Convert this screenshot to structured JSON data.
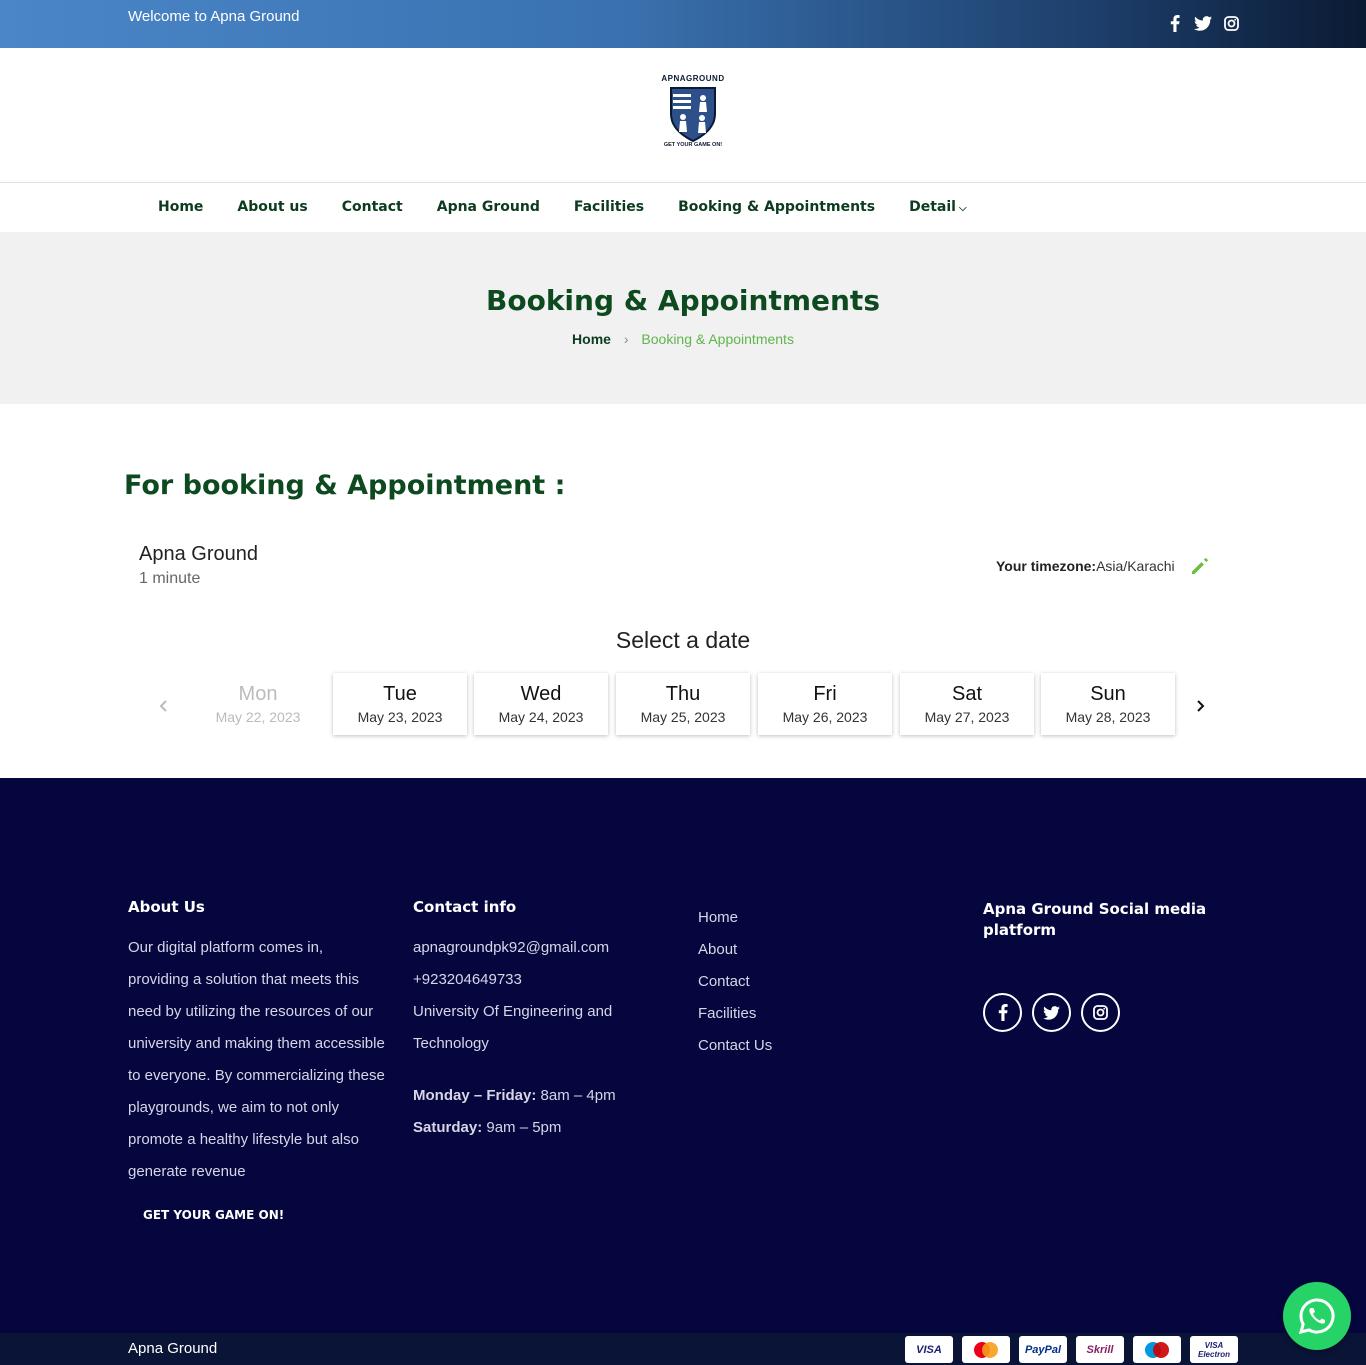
{
  "topbar": {
    "welcome": "Welcome to Apna Ground"
  },
  "logo": {
    "arc_text": "APNAGROUND",
    "tagline": "GET YOUR GAME ON!"
  },
  "nav": {
    "items": [
      "Home",
      "About us",
      "Contact",
      "Apna Ground",
      "Facilities",
      "Booking & Appointments",
      "Detail"
    ]
  },
  "hero": {
    "title": "Booking & Appointments",
    "crumb_home": "Home",
    "crumb_current": "Booking & Appointments"
  },
  "booking": {
    "section_title": "For booking & Appointment :",
    "event_name": "Apna Ground",
    "duration": "1 minute",
    "timezone_label": "Your timezone:",
    "timezone_value": "Asia/Karachi",
    "select_date": "Select a date",
    "days": [
      {
        "name": "Mon",
        "date": "May 22, 2023",
        "available": false
      },
      {
        "name": "Tue",
        "date": "May 23, 2023",
        "available": true
      },
      {
        "name": "Wed",
        "date": "May 24, 2023",
        "available": true
      },
      {
        "name": "Thu",
        "date": "May 25, 2023",
        "available": true
      },
      {
        "name": "Fri",
        "date": "May 26, 2023",
        "available": true
      },
      {
        "name": "Sat",
        "date": "May 27, 2023",
        "available": true
      },
      {
        "name": "Sun",
        "date": "May 28, 2023",
        "available": true
      }
    ]
  },
  "footer": {
    "about_title": "About Us",
    "about_text": "Our digital platform comes in, providing a solution that meets this need by utilizing the resources of our university and making them accessible to everyone. By commercializing these playgrounds, we aim to not only promote a healthy lifestyle but also generate revenue",
    "about_tagline": "GET YOUR GAME ON!",
    "contact_title": "Contact info",
    "email": "apnagroundpk92@gmail.com",
    "phone": "+923204649733",
    "address": "University Of Engineering and Technology",
    "weekday_label": "Monday – Friday:",
    "weekday_hours": "8am – 4pm",
    "saturday_label": "Saturday:",
    "saturday_hours": "9am – 5pm",
    "links": [
      "Home",
      "About",
      "Contact",
      "Facilities",
      "Contact Us"
    ],
    "social_title": "Apna Ground Social media platform"
  },
  "bottom": {
    "copyright": "Apna Ground",
    "cards": [
      {
        "label": "VISA",
        "color": "#1a1f71"
      },
      {
        "label": "MC",
        "color": "#eb001b"
      },
      {
        "label": "PayPal",
        "color": "#003087"
      },
      {
        "label": "Skrill",
        "color": "#862165"
      },
      {
        "label": "Maestro",
        "color": "#cc0000"
      },
      {
        "label": "VISA Electron",
        "color": "#1a1f71"
      }
    ]
  },
  "colors": {
    "brand_green": "#0d4a1f",
    "accent_green": "#5fb54e",
    "footer_bg": "#06063f",
    "whatsapp": "#25d366"
  }
}
